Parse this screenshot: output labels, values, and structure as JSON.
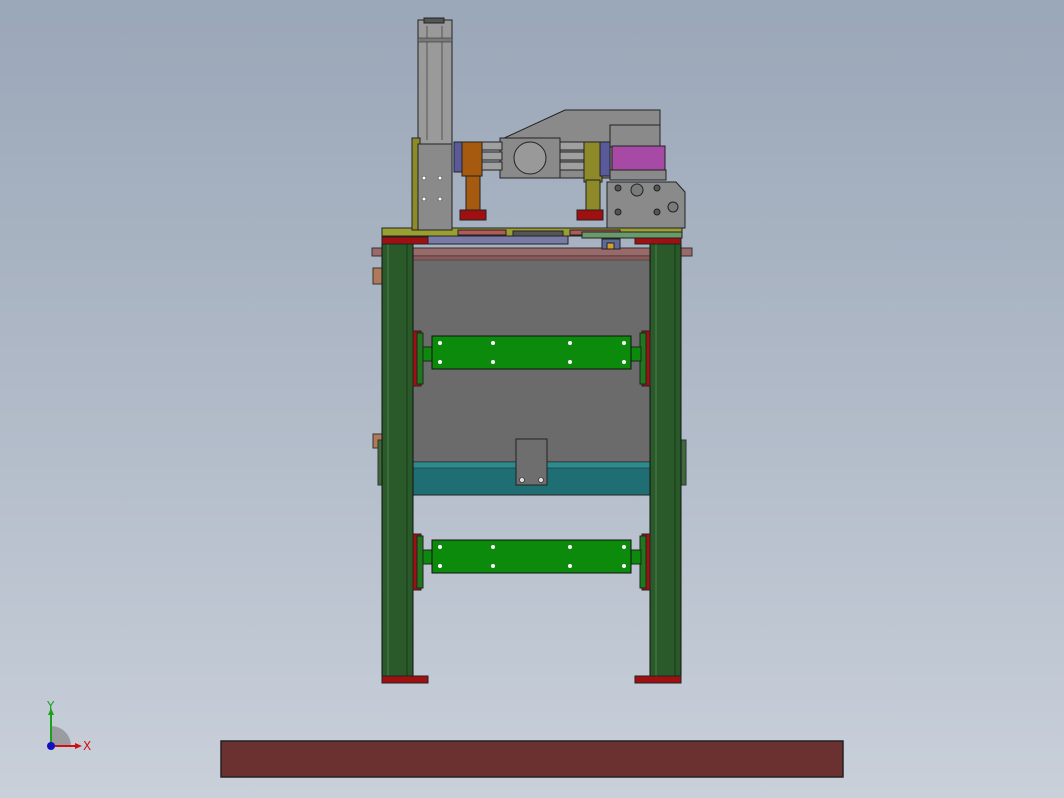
{
  "viewport": {
    "name": "cad-3d-viewport",
    "background": "#b0bac8"
  },
  "triad": {
    "x_label": "X",
    "y_label": "Y",
    "x_color": "#d01010",
    "y_color": "#1aa01a",
    "z_color": "#1010c0"
  },
  "model": {
    "colors": {
      "frame_green": "#2a5a2a",
      "pad_red": "#a01010",
      "panel_gray": "#6b6b6b",
      "rail_green": "#0c8a0c",
      "base_teal": "#1f6e73",
      "actuator_gray": "#8a8a8a",
      "motor_purple": "#a64aa6",
      "bracket_olive": "#8e8a2a",
      "bracket_brown": "#a65a10",
      "floor_bar": "#6b3131"
    }
  }
}
